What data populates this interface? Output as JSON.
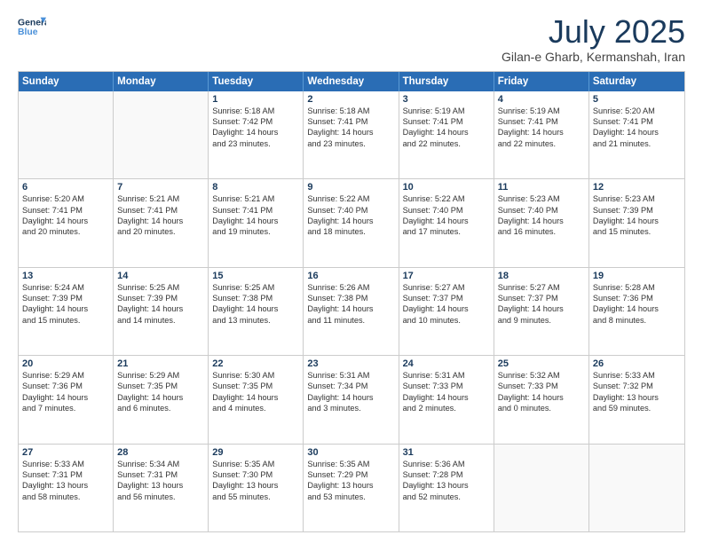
{
  "logo": {
    "line1": "General",
    "line2": "Blue"
  },
  "header": {
    "month": "July 2025",
    "location": "Gilan-e Gharb, Kermanshah, Iran"
  },
  "weekdays": [
    "Sunday",
    "Monday",
    "Tuesday",
    "Wednesday",
    "Thursday",
    "Friday",
    "Saturday"
  ],
  "weeks": [
    [
      {
        "day": null
      },
      {
        "day": null
      },
      {
        "day": "1",
        "lines": [
          "Sunrise: 5:18 AM",
          "Sunset: 7:42 PM",
          "Daylight: 14 hours",
          "and 23 minutes."
        ]
      },
      {
        "day": "2",
        "lines": [
          "Sunrise: 5:18 AM",
          "Sunset: 7:41 PM",
          "Daylight: 14 hours",
          "and 23 minutes."
        ]
      },
      {
        "day": "3",
        "lines": [
          "Sunrise: 5:19 AM",
          "Sunset: 7:41 PM",
          "Daylight: 14 hours",
          "and 22 minutes."
        ]
      },
      {
        "day": "4",
        "lines": [
          "Sunrise: 5:19 AM",
          "Sunset: 7:41 PM",
          "Daylight: 14 hours",
          "and 22 minutes."
        ]
      },
      {
        "day": "5",
        "lines": [
          "Sunrise: 5:20 AM",
          "Sunset: 7:41 PM",
          "Daylight: 14 hours",
          "and 21 minutes."
        ]
      }
    ],
    [
      {
        "day": "6",
        "lines": [
          "Sunrise: 5:20 AM",
          "Sunset: 7:41 PM",
          "Daylight: 14 hours",
          "and 20 minutes."
        ]
      },
      {
        "day": "7",
        "lines": [
          "Sunrise: 5:21 AM",
          "Sunset: 7:41 PM",
          "Daylight: 14 hours",
          "and 20 minutes."
        ]
      },
      {
        "day": "8",
        "lines": [
          "Sunrise: 5:21 AM",
          "Sunset: 7:41 PM",
          "Daylight: 14 hours",
          "and 19 minutes."
        ]
      },
      {
        "day": "9",
        "lines": [
          "Sunrise: 5:22 AM",
          "Sunset: 7:40 PM",
          "Daylight: 14 hours",
          "and 18 minutes."
        ]
      },
      {
        "day": "10",
        "lines": [
          "Sunrise: 5:22 AM",
          "Sunset: 7:40 PM",
          "Daylight: 14 hours",
          "and 17 minutes."
        ]
      },
      {
        "day": "11",
        "lines": [
          "Sunrise: 5:23 AM",
          "Sunset: 7:40 PM",
          "Daylight: 14 hours",
          "and 16 minutes."
        ]
      },
      {
        "day": "12",
        "lines": [
          "Sunrise: 5:23 AM",
          "Sunset: 7:39 PM",
          "Daylight: 14 hours",
          "and 15 minutes."
        ]
      }
    ],
    [
      {
        "day": "13",
        "lines": [
          "Sunrise: 5:24 AM",
          "Sunset: 7:39 PM",
          "Daylight: 14 hours",
          "and 15 minutes."
        ]
      },
      {
        "day": "14",
        "lines": [
          "Sunrise: 5:25 AM",
          "Sunset: 7:39 PM",
          "Daylight: 14 hours",
          "and 14 minutes."
        ]
      },
      {
        "day": "15",
        "lines": [
          "Sunrise: 5:25 AM",
          "Sunset: 7:38 PM",
          "Daylight: 14 hours",
          "and 13 minutes."
        ]
      },
      {
        "day": "16",
        "lines": [
          "Sunrise: 5:26 AM",
          "Sunset: 7:38 PM",
          "Daylight: 14 hours",
          "and 11 minutes."
        ]
      },
      {
        "day": "17",
        "lines": [
          "Sunrise: 5:27 AM",
          "Sunset: 7:37 PM",
          "Daylight: 14 hours",
          "and 10 minutes."
        ]
      },
      {
        "day": "18",
        "lines": [
          "Sunrise: 5:27 AM",
          "Sunset: 7:37 PM",
          "Daylight: 14 hours",
          "and 9 minutes."
        ]
      },
      {
        "day": "19",
        "lines": [
          "Sunrise: 5:28 AM",
          "Sunset: 7:36 PM",
          "Daylight: 14 hours",
          "and 8 minutes."
        ]
      }
    ],
    [
      {
        "day": "20",
        "lines": [
          "Sunrise: 5:29 AM",
          "Sunset: 7:36 PM",
          "Daylight: 14 hours",
          "and 7 minutes."
        ]
      },
      {
        "day": "21",
        "lines": [
          "Sunrise: 5:29 AM",
          "Sunset: 7:35 PM",
          "Daylight: 14 hours",
          "and 6 minutes."
        ]
      },
      {
        "day": "22",
        "lines": [
          "Sunrise: 5:30 AM",
          "Sunset: 7:35 PM",
          "Daylight: 14 hours",
          "and 4 minutes."
        ]
      },
      {
        "day": "23",
        "lines": [
          "Sunrise: 5:31 AM",
          "Sunset: 7:34 PM",
          "Daylight: 14 hours",
          "and 3 minutes."
        ]
      },
      {
        "day": "24",
        "lines": [
          "Sunrise: 5:31 AM",
          "Sunset: 7:33 PM",
          "Daylight: 14 hours",
          "and 2 minutes."
        ]
      },
      {
        "day": "25",
        "lines": [
          "Sunrise: 5:32 AM",
          "Sunset: 7:33 PM",
          "Daylight: 14 hours",
          "and 0 minutes."
        ]
      },
      {
        "day": "26",
        "lines": [
          "Sunrise: 5:33 AM",
          "Sunset: 7:32 PM",
          "Daylight: 13 hours",
          "and 59 minutes."
        ]
      }
    ],
    [
      {
        "day": "27",
        "lines": [
          "Sunrise: 5:33 AM",
          "Sunset: 7:31 PM",
          "Daylight: 13 hours",
          "and 58 minutes."
        ]
      },
      {
        "day": "28",
        "lines": [
          "Sunrise: 5:34 AM",
          "Sunset: 7:31 PM",
          "Daylight: 13 hours",
          "and 56 minutes."
        ]
      },
      {
        "day": "29",
        "lines": [
          "Sunrise: 5:35 AM",
          "Sunset: 7:30 PM",
          "Daylight: 13 hours",
          "and 55 minutes."
        ]
      },
      {
        "day": "30",
        "lines": [
          "Sunrise: 5:35 AM",
          "Sunset: 7:29 PM",
          "Daylight: 13 hours",
          "and 53 minutes."
        ]
      },
      {
        "day": "31",
        "lines": [
          "Sunrise: 5:36 AM",
          "Sunset: 7:28 PM",
          "Daylight: 13 hours",
          "and 52 minutes."
        ]
      },
      {
        "day": null
      },
      {
        "day": null
      }
    ]
  ]
}
